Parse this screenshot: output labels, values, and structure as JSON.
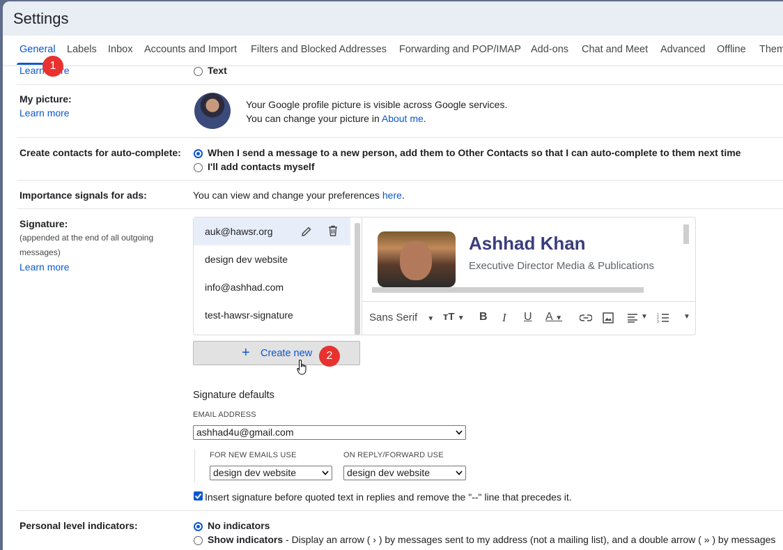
{
  "title": "Settings",
  "tabs": [
    {
      "label": "General"
    },
    {
      "label": "Labels"
    },
    {
      "label": "Inbox"
    },
    {
      "label": "Accounts and Import"
    },
    {
      "label": "Filters and Blocked Addresses"
    },
    {
      "label": "Forwarding and POP/IMAP"
    },
    {
      "label": "Add-ons"
    },
    {
      "label": "Chat and Meet"
    },
    {
      "label": "Advanced"
    },
    {
      "label": "Offline"
    },
    {
      "label": "Them"
    }
  ],
  "badges": {
    "one": "1",
    "two": "2"
  },
  "top_partial": {
    "learn_more": "Learn more",
    "text_option": "Text"
  },
  "my_picture": {
    "label": "My picture:",
    "learn_more": "Learn more",
    "line1": "Your Google profile picture is visible across Google services.",
    "line2_prefix": "You can change your picture in ",
    "line2_link": "About me",
    "line2_suffix": "."
  },
  "auto_complete": {
    "label": "Create contacts for auto-complete:",
    "option1": "When I send a message to a new person, add them to Other Contacts so that I can auto-complete to them next time",
    "option2": "I'll add contacts myself"
  },
  "importance": {
    "label": "Importance signals for ads:",
    "text_prefix": "You can view and change your preferences ",
    "link": "here",
    "text_suffix": "."
  },
  "signature": {
    "label": "Signature:",
    "note_line1": "(appended at the end of all outgoing",
    "note_line2": "messages)",
    "learn_more": "Learn more",
    "items": [
      {
        "name": "auk@hawsr.org"
      },
      {
        "name": "design dev website"
      },
      {
        "name": "info@ashhad.com"
      },
      {
        "name": "test-hawsr-signature"
      }
    ],
    "preview_name": "Ashhad Khan",
    "preview_role": "Executive Director Media & Publications",
    "toolbar_font": "Sans Serif",
    "create_new": "Create new",
    "defaults_title": "Signature defaults",
    "email_address_label": "EMAIL ADDRESS",
    "email_address_value": "ashhad4u@gmail.com",
    "new_emails_label": "FOR NEW EMAILS USE",
    "new_emails_value": "design dev website",
    "reply_label": "ON REPLY/FORWARD USE",
    "reply_value": "design dev website",
    "insert_before": "Insert signature before quoted text in replies and remove the \"--\" line that precedes it."
  },
  "personal_level": {
    "label": "Personal level indicators:",
    "option1": "No indicators",
    "option2_bold": "Show indicators",
    "option2_rest": " - Display an arrow ( › ) by messages sent to my address (not a mailing list), and a double arrow ( » ) by messages"
  },
  "colors": {
    "accent": "#0b57d0",
    "badge": "#e8322f",
    "title_bar": "#e9edf4"
  }
}
